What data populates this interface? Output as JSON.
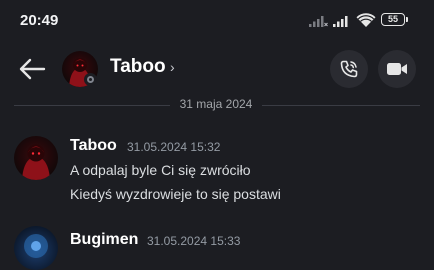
{
  "status_bar": {
    "time": "20:49",
    "battery": "55",
    "icons": [
      "signal-off-icon",
      "signal-icon",
      "wifi-icon",
      "battery-icon"
    ]
  },
  "header": {
    "title": "Taboo",
    "chevron": "›",
    "icons": [
      "back-arrow-icon",
      "phone-call-icon",
      "video-camera-icon"
    ],
    "status": "offline"
  },
  "date_divider": "31 maja 2024",
  "messages": [
    {
      "author": "Taboo",
      "timestamp": "31.05.2024 15:32",
      "lines": [
        "A odpalaj byle Ci się zwróciło",
        "Kiedyś wyzdrowieje to się postawi"
      ]
    },
    {
      "author": "Bugimen",
      "timestamp": "31.05.2024 15:33",
      "lines": []
    }
  ],
  "colors": {
    "background": "#1c1d22",
    "button_bg": "#2a2b31",
    "text_primary": "#ffffff",
    "text_secondary": "#949ba4",
    "avatar_red": "#b3141d"
  }
}
